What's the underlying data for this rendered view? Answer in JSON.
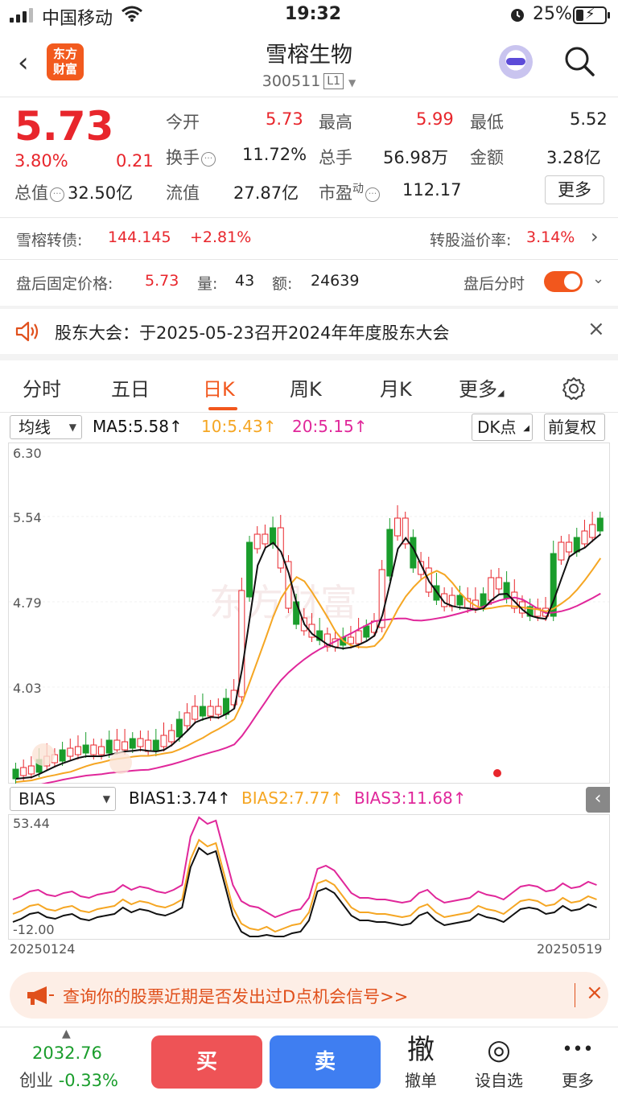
{
  "status": {
    "carrier": "中国移动",
    "time": "19:32",
    "battery": "25%"
  },
  "header": {
    "back_icon": "‹",
    "logo_text": "东方财富",
    "name": "雪榕生物",
    "code": "300511",
    "level": "L1"
  },
  "quote": {
    "price": "5.73",
    "pct": "3.80%",
    "change": "0.21",
    "zongzhi_label": "总值",
    "zongzhi_value": "32.50亿",
    "cells": [
      {
        "label": "今开",
        "value": "5.73",
        "color": "red"
      },
      {
        "label": "最高",
        "value": "5.99",
        "color": "red"
      },
      {
        "label": "最低",
        "value": "5.52",
        "color": "black"
      },
      {
        "label": "换手",
        "value": "11.72%",
        "color": "black"
      },
      {
        "label": "总手",
        "value": "56.98万",
        "color": "black"
      },
      {
        "label": "金额",
        "value": "3.28亿",
        "color": "black"
      },
      {
        "label": "流值",
        "value": "27.87亿",
        "color": "black"
      },
      {
        "label": "市盈",
        "sup": "动",
        "value": "112.17",
        "color": "black"
      }
    ],
    "more": "更多"
  },
  "bond": {
    "label": "雪榕转债:",
    "price": "144.145",
    "change": "+2.81%",
    "premium_label": "转股溢价率:",
    "premium": "3.14%"
  },
  "afterhours": {
    "label": "盘后固定价格:",
    "price": "5.73",
    "vol_label": "量:",
    "vol": "43",
    "amt_label": "额:",
    "amt": "24639",
    "toggle_label": "盘后分时",
    "toggle_on": true
  },
  "notice": {
    "text": "股东大会：于2025-05-23召开2024年年度股东大会"
  },
  "tabs": [
    "分时",
    "五日",
    "日K",
    "周K",
    "月K",
    "更多"
  ],
  "active_tab": "日K",
  "kline": {
    "indicator": "均线",
    "ma5": "MA5:5.58",
    "ma10": "10:5.43",
    "ma20": "20:5.15",
    "dk": "DK点",
    "adjust": "前复权",
    "yticks": [
      "6.30",
      "5.54",
      "4.79",
      "4.03"
    ],
    "colors": {
      "up": "#e8262c",
      "down": "#1a9d2c",
      "ma5": "#111111",
      "ma10": "#f5a623",
      "ma20": "#e0279a"
    }
  },
  "bias": {
    "indicator": "BIAS",
    "b1": "BIAS1:3.74",
    "b2": "BIAS2:7.77",
    "b3": "BIAS3:11.68",
    "ymax": "53.44",
    "ymin": "-12.00",
    "date_start": "20250124",
    "date_end": "20250519"
  },
  "banner": {
    "text": "查询你的股票近期是否发出过D点机会信号>>"
  },
  "bottom": {
    "index_value": "2032.76",
    "index_name": "创业",
    "index_change": "-0.33%",
    "buy": "买",
    "sell": "卖",
    "items": [
      {
        "icon": "撤",
        "label": "撤单"
      },
      {
        "icon": "◎",
        "label": "设自选"
      },
      {
        "icon": "•••",
        "label": "更多"
      }
    ]
  }
}
